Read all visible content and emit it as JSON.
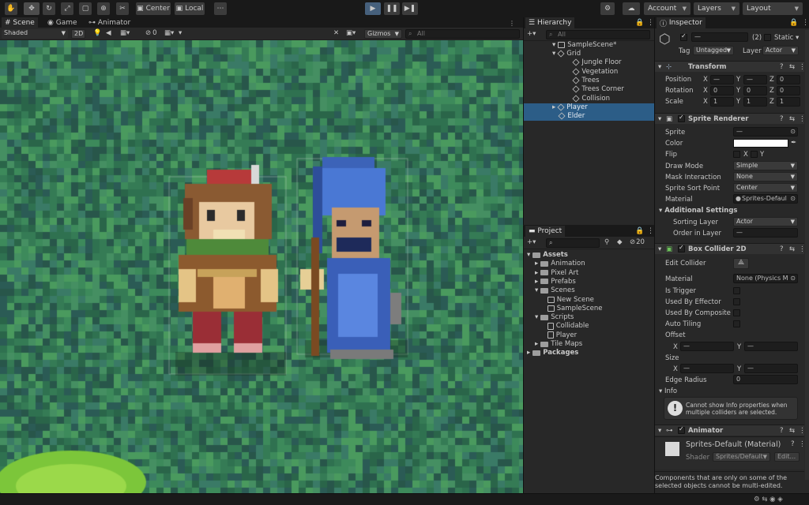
{
  "toolbar": {
    "tools": [
      "hand-tool",
      "move-tool",
      "rotate-tool",
      "scale-tool",
      "rect-tool",
      "transform-tool",
      "custom-tool"
    ],
    "pivot": "Center",
    "space": "Local",
    "account": "Account",
    "layers": "Layers",
    "layout": "Layout"
  },
  "scene": {
    "tabs": [
      "Scene",
      "Game",
      "Animator"
    ],
    "shading": "Shaded",
    "mode2d": "2D",
    "hidden_count": "0",
    "gizmos": "Gizmos",
    "search_placeholder": "All"
  },
  "hierarchy": {
    "tab": "Hierarchy",
    "search_placeholder": "All",
    "scene": "SampleScene*",
    "items": [
      {
        "label": "Grid",
        "depth": 2,
        "expanded": true
      },
      {
        "label": "Jungle Floor",
        "depth": 3
      },
      {
        "label": "Vegetation",
        "depth": 3
      },
      {
        "label": "Trees",
        "depth": 3
      },
      {
        "label": "Trees Corner",
        "depth": 3
      },
      {
        "label": "Collision",
        "depth": 3
      },
      {
        "label": "Player",
        "depth": 2,
        "selected": true,
        "collapsed": true
      },
      {
        "label": "Elder",
        "depth": 2,
        "selected": true
      }
    ]
  },
  "project": {
    "tab": "Project",
    "hidden_count": "20",
    "items": [
      {
        "label": "Assets",
        "type": "folder",
        "depth": 0,
        "expanded": true,
        "bold": true
      },
      {
        "label": "Animation",
        "type": "folder",
        "depth": 1
      },
      {
        "label": "Pixel Art",
        "type": "folder",
        "depth": 1
      },
      {
        "label": "Prefabs",
        "type": "folder",
        "depth": 1
      },
      {
        "label": "Scenes",
        "type": "folder",
        "depth": 1,
        "expanded": true
      },
      {
        "label": "New Scene",
        "type": "scene",
        "depth": 2
      },
      {
        "label": "SampleScene",
        "type": "scene",
        "depth": 2
      },
      {
        "label": "Scripts",
        "type": "folder",
        "depth": 1,
        "expanded": true
      },
      {
        "label": "Collidable",
        "type": "script",
        "depth": 2
      },
      {
        "label": "Player",
        "type": "script",
        "depth": 2
      },
      {
        "label": "Tile Maps",
        "type": "folder",
        "depth": 1
      },
      {
        "label": "Packages",
        "type": "folder",
        "depth": 0,
        "bold": true
      }
    ]
  },
  "inspector": {
    "tab": "Inspector",
    "name_value": "—",
    "count": "(2)",
    "static": "Static",
    "tag_label": "Tag",
    "tag": "Untagged",
    "layer_label": "Layer",
    "layer": "Actor",
    "transform": {
      "title": "Transform",
      "rows": [
        {
          "label": "Position",
          "x": "—",
          "y": "—",
          "z": "0"
        },
        {
          "label": "Rotation",
          "x": "0",
          "y": "0",
          "z": "0"
        },
        {
          "label": "Scale",
          "x": "1",
          "y": "1",
          "z": "1"
        }
      ]
    },
    "sprite_renderer": {
      "title": "Sprite Renderer",
      "sprite_label": "Sprite",
      "sprite": "—",
      "color_label": "Color",
      "flip_label": "Flip",
      "flip_x": "X",
      "flip_y": "Y",
      "draw_mode_label": "Draw Mode",
      "draw_mode": "Simple",
      "mask_label": "Mask Interaction",
      "mask": "None",
      "sort_point_label": "Sprite Sort Point",
      "sort_point": "Center",
      "material_label": "Material",
      "material": "Sprites-Defaul",
      "additional": "Additional Settings",
      "sorting_layer_label": "Sorting Layer",
      "sorting_layer": "Actor",
      "order_label": "Order in Layer",
      "order": "—"
    },
    "box_collider": {
      "title": "Box Collider 2D",
      "edit_label": "Edit Collider",
      "material_label": "Material",
      "material": "None (Physics M",
      "is_trigger": "Is Trigger",
      "used_by_effector": "Used By Effector",
      "used_by_composite": "Used By Composite",
      "auto_tiling": "Auto Tiling",
      "offset_label": "Offset",
      "offset_x": "X",
      "offset_x_val": "—",
      "offset_y": "Y",
      "offset_y_val": "—",
      "size_label": "Size",
      "size_x": "X",
      "size_x_val": "—",
      "size_y": "Y",
      "size_y_val": "—",
      "edge_radius_label": "Edge Radius",
      "edge_radius": "0",
      "info_label": "Info",
      "info_text": "Cannot show Info properties when multiple colliders are selected."
    },
    "animator": {
      "title": "Animator"
    },
    "material": {
      "name": "Sprites-Default (Material)",
      "shader_label": "Shader",
      "shader": "Sprites/Default",
      "edit": "Edit..."
    },
    "footer": "Components that are only on some of the selected objects cannot be multi-edited."
  },
  "colors": {
    "grass_dark": "#2c6b4a",
    "grass_light": "#3f9a5f",
    "selection": "#2c5d87",
    "play_blue": "#46607c"
  }
}
